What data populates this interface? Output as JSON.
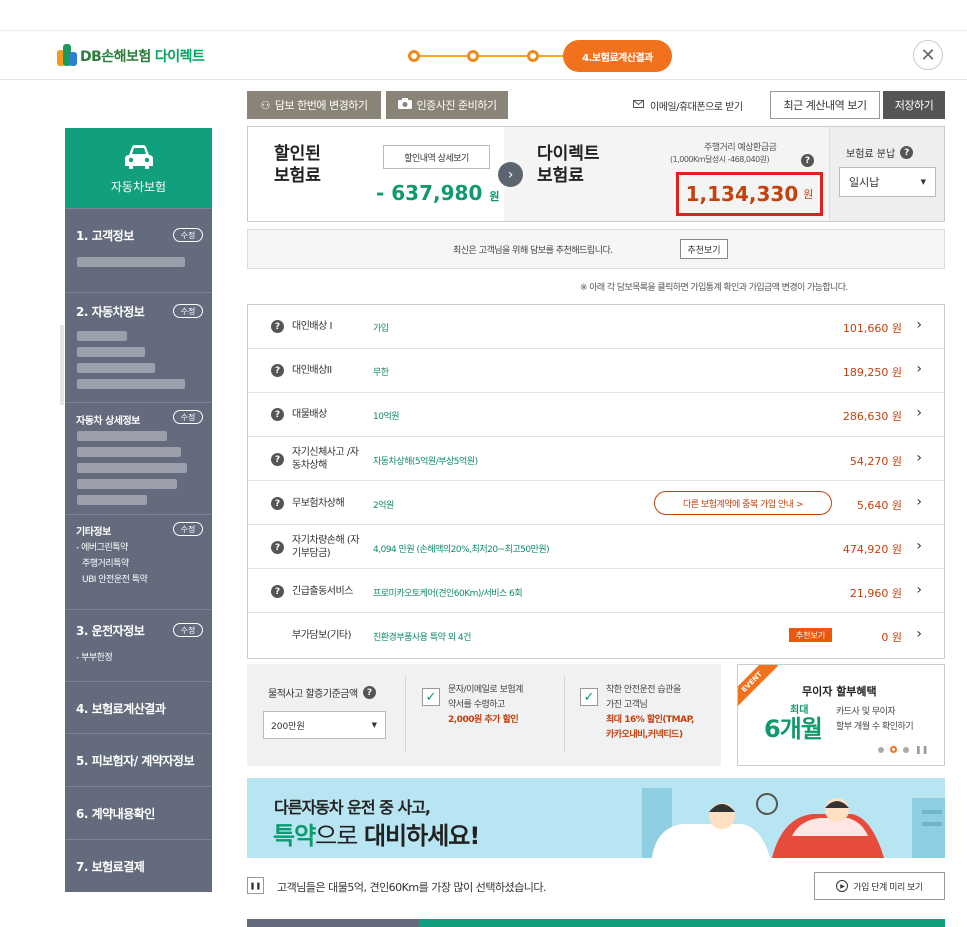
{
  "header": {
    "logo_text": "DB손해보험",
    "logo_direct": "다이렉트",
    "current_step": "4.보험료계산결과",
    "close_icon": "close-icon"
  },
  "sidebar": {
    "car_label": "자동차보험",
    "sections": [
      {
        "title": "1. 고객정보",
        "edit": "수정"
      },
      {
        "title": "2. 자동차정보",
        "edit": "수정"
      },
      {
        "title": "자동차 상세정보",
        "edit": "수정"
      },
      {
        "title": "기타정보",
        "edit": "수정",
        "sub": [
          "- 에버그린특약",
          "주행거리특약",
          "UBI 안전운전 특약"
        ]
      },
      {
        "title": "3. 운전자정보",
        "edit": "수정",
        "sub": [
          "- 부부한정"
        ]
      },
      {
        "title": "4. 보험료계산결과"
      },
      {
        "title": "5. 피보험자/ 계약자정보"
      },
      {
        "title": "6. 계약내용확인"
      },
      {
        "title": "7. 보험료결제"
      }
    ]
  },
  "toolbar": {
    "change_coverage": "담보 한번에 변경하기",
    "prepare_photo": "인증사진 준비하기",
    "email_receive": "이메일/휴대폰으로 받기",
    "recent_history": "최근 계산내역 보기",
    "save": "저장하기"
  },
  "premium": {
    "discounted_label_1": "할인된",
    "discounted_label_2": "보험료",
    "discount_detail": "할인내역 상세보기",
    "discount_amount": "- 637,980",
    "won": "원",
    "direct_label_1": "다이렉트",
    "direct_label_2": "보험료",
    "mileage_label": "주행거리 예상환급금",
    "mileage_sub": "(1,000Km달성시 -468,040원)",
    "direct_amount": "1,134,330",
    "payment_label": "보험료 분납",
    "payment_option": "일시납"
  },
  "notice": {
    "text": "최신은 고객님을 위해 담보를 추천해드립니다.",
    "recommend_button": "추천보기",
    "hint": "※ 아래 각 담보목록을 클릭하면 가입통계 확인과 가입금액 변경이 가능합니다."
  },
  "coverages": [
    {
      "name": "대인배상 I",
      "value": "가입",
      "amount": "101,660 원"
    },
    {
      "name": "대인배상II",
      "value": "무한",
      "amount": "189,250 원"
    },
    {
      "name": "대물배상",
      "value": "10억원",
      "amount": "286,630 원"
    },
    {
      "name": "자기신체사고 /자동차상해",
      "value": "자동차상해(5억원/부상5억원)",
      "amount": "54,270 원"
    },
    {
      "name": "무보험차상해",
      "value": "2억원",
      "amount": "5,640 원",
      "badge": "다른 보험계약에 중복 가입 안내 >"
    },
    {
      "name": "자기차량손해 (자기부담금)",
      "value": "4,094 만원 (손해액의20%,최저20~최고50만원)",
      "amount": "474,920 원"
    },
    {
      "name": "긴급출동서비스",
      "value": "프로미카오토케어(견인60Km)/서비스 6회",
      "amount": "21,960 원"
    },
    {
      "name": "부가담보(기타)",
      "value": "친환경부품사용 특약 외 4건",
      "amount": "0 원",
      "tag": "추천보기"
    }
  ],
  "options": {
    "property_label": "물적사고 할증기준금액",
    "property_value": "200만원",
    "sms_line1": "문자/이메일로 보험계",
    "sms_line2": "약서를 수령하고",
    "sms_discount": "2,000원 추가 할인",
    "safe_line1": "착한 안전운전 습관을",
    "safe_line2": "가진 고객님",
    "safe_discount1": "최대 16% 할인(TMAP,",
    "safe_discount2": "카카오내비,커넥티드)"
  },
  "event": {
    "tag": "EVENT",
    "title": "무이자 할부혜택",
    "big_top": "최대",
    "big_num": "6개월",
    "desc1": "카드사 및 무이자",
    "desc2": "할부 개월 수 확인하기"
  },
  "banner": {
    "line1": "다른자동차 운전 중 사고,",
    "line2a": "특약",
    "line2b": "으로 ",
    "line2c": "대비하세요!"
  },
  "footer": {
    "tip": "고객님들은 대물5억, 견인60Km를 가장 많이 선택하셨습니다.",
    "preview_button": "가입 단계 미리 보기"
  },
  "colors": {
    "green": "#11a07d",
    "orange": "#f2711c",
    "red_box": "#e01f1f",
    "sidebar": "#636b7d"
  }
}
